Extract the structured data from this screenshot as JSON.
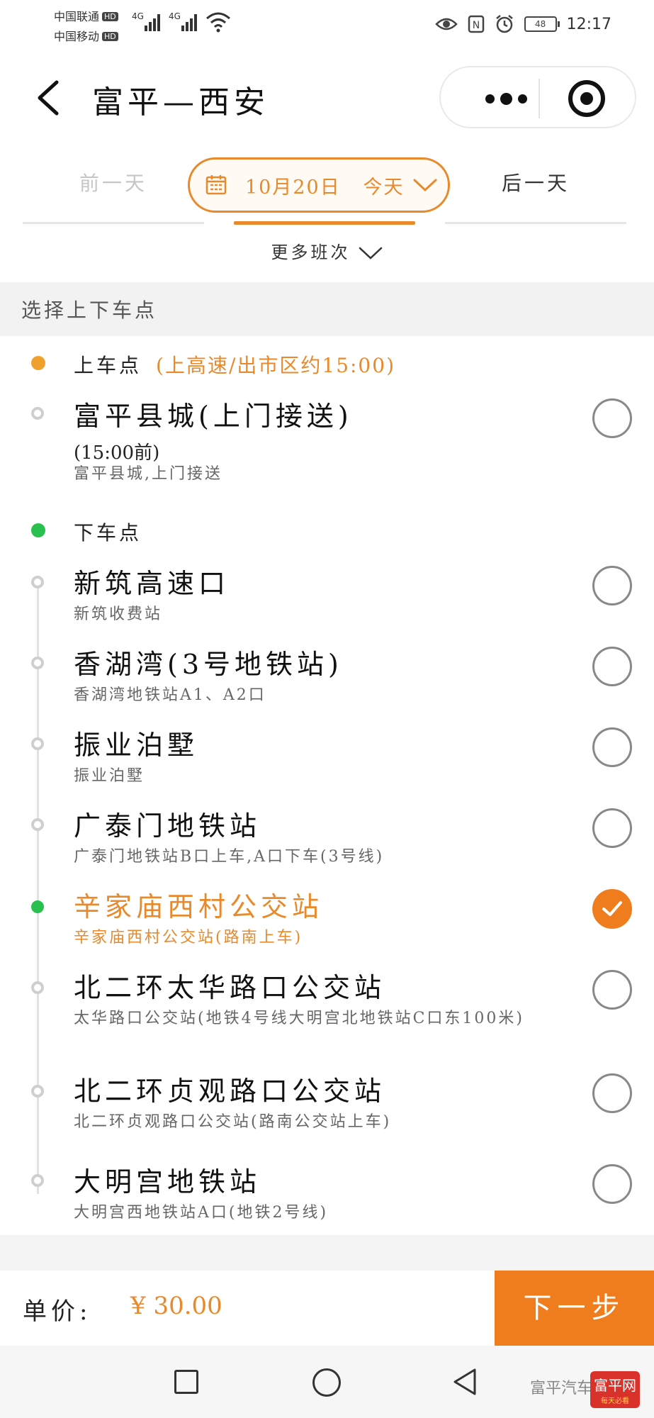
{
  "status_bar": {
    "carrier1": "中国联通",
    "carrier2": "中国移动",
    "hd": "HD",
    "net": "4G",
    "battery": "48",
    "time": "12:17"
  },
  "header": {
    "title": "富平—西安"
  },
  "date_bar": {
    "prev_label": "前一天",
    "date_label": "10月20日",
    "today_label": "今天",
    "next_label": "后一天",
    "more_label": "更多班次"
  },
  "section": {
    "title": "选择上下车点"
  },
  "boarding": {
    "label": "上车点",
    "note": "(上高速/出市区约15:00)",
    "stops": [
      {
        "name": "富平县城(上门接送)",
        "time": "(15:00前)",
        "sub": "富平县城,上门接送",
        "selected": false
      }
    ]
  },
  "alighting": {
    "label": "下车点",
    "stops": [
      {
        "name": "新筑高速口",
        "sub": "新筑收费站",
        "selected": false
      },
      {
        "name": "香湖湾(3号地铁站)",
        "sub": "香湖湾地铁站A1、A2口",
        "selected": false
      },
      {
        "name": "振业泊墅",
        "sub": "振业泊墅",
        "selected": false
      },
      {
        "name": "广泰门地铁站",
        "sub": "广泰门地铁站B口上车,A口下车(3号线)",
        "selected": false
      },
      {
        "name": "辛家庙西村公交站",
        "sub": "辛家庙西村公交站(路南上车)",
        "selected": true
      },
      {
        "name": "北二环太华路口公交站",
        "sub": "太华路口公交站(地铁4号线大明宫北地铁站C口东100米)",
        "selected": false
      },
      {
        "name": "北二环贞观路口公交站",
        "sub": "北二环贞观路口公交站(路南公交站上车)",
        "selected": false
      },
      {
        "name": "大明宫地铁站",
        "sub": "大明宫西地铁站A口(地铁2号线)",
        "selected": false
      }
    ]
  },
  "footer": {
    "price_label": "单价:",
    "price_value": "¥ 30.00",
    "next_label": "下一步"
  },
  "watermark": {
    "text": "富平汽车站",
    "badge": "富平网",
    "badge_sub": "每天必看"
  },
  "colors": {
    "accent": "#e8892c",
    "button": "#f07d1d",
    "boarding_dot": "#f0a02d",
    "alight_dot": "#29c04f"
  }
}
